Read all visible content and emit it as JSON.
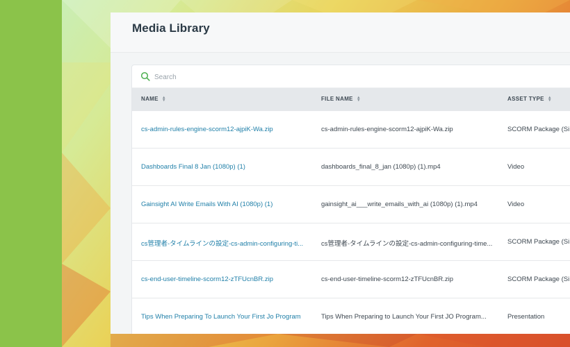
{
  "colors": {
    "sidebar_green": "#8bc34a",
    "link_blue": "#1f7fa8",
    "title_text": "#2b3a46",
    "search_icon": "#4caf50"
  },
  "page": {
    "title": "Media Library"
  },
  "search": {
    "placeholder": "Search",
    "icon": "search-icon"
  },
  "table": {
    "columns": [
      {
        "label": "NAME",
        "icon": "sort-icon"
      },
      {
        "label": "FILE NAME",
        "icon": "sort-icon"
      },
      {
        "label": "ASSET TYPE",
        "icon": "sort-icon"
      }
    ],
    "rows": [
      {
        "name": "cs-admin-rules-engine-scorm12-ajpiK-Wa.zip",
        "file_name": "cs-admin-rules-engine-scorm12-ajpiK-Wa.zip",
        "asset_type": "SCORM Package (Si"
      },
      {
        "name": "Dashboards Final 8 Jan (1080p) (1)",
        "file_name": "dashboards_final_8_jan (1080p) (1).mp4",
        "asset_type": "Video"
      },
      {
        "name": "Gainsight AI Write Emails With AI (1080p) (1)",
        "file_name": "gainsight_ai___write_emails_with_ai (1080p) (1).mp4",
        "asset_type": "Video"
      },
      {
        "name": "cs管理者-タイムラインの設定-cs-admin-configuring-ti...",
        "file_name": "cs管理者-タイムラインの設定-cs-admin-configuring-time...",
        "asset_type": "SCORM Package (Si"
      },
      {
        "name": "cs-end-user-timeline-scorm12-zTFUcnBR.zip",
        "file_name": "cs-end-user-timeline-scorm12-zTFUcnBR.zip",
        "asset_type": "SCORM Package (Si"
      },
      {
        "name": "Tips When Preparing To Launch Your First Jo Program",
        "file_name": "Tips When Preparing to Launch Your First JO Program...",
        "asset_type": "Presentation"
      }
    ]
  }
}
